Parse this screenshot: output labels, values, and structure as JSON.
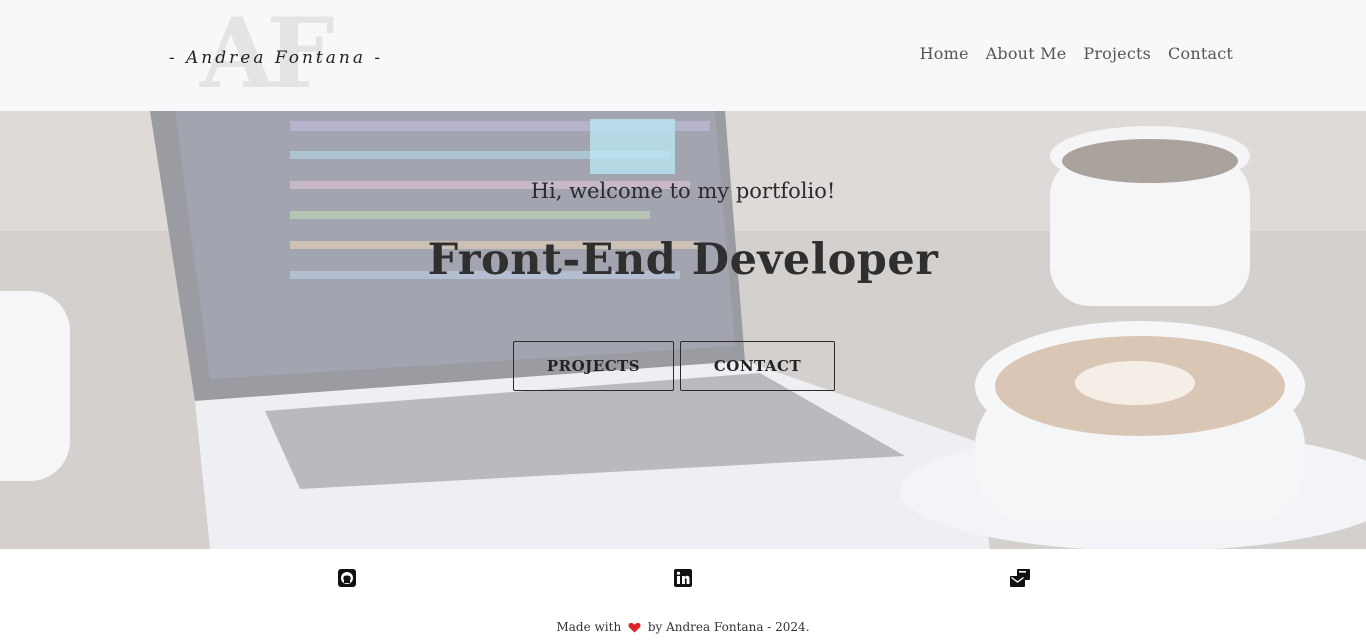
{
  "header": {
    "logo_monogram": "AF",
    "logo_text": "- Andrea Fontana -",
    "nav": [
      {
        "label": "Home"
      },
      {
        "label": "About Me"
      },
      {
        "label": "Projects"
      },
      {
        "label": "Contact"
      }
    ]
  },
  "hero": {
    "greeting": "Hi, welcome to my portfolio!",
    "title": "Front-End Developer",
    "buttons": {
      "projects": "PROJECTS",
      "contact": "CONTACT"
    }
  },
  "footer": {
    "social": [
      {
        "icon": "github-icon"
      },
      {
        "icon": "linkedin-icon"
      },
      {
        "icon": "mail-icon"
      }
    ],
    "credits_prefix": "Made with",
    "credits_suffix": "by Andrea Fontana - 2024.",
    "heart_color": "#e02424"
  },
  "colors": {
    "header_bg": "#f7f8fa",
    "text": "#333333"
  }
}
